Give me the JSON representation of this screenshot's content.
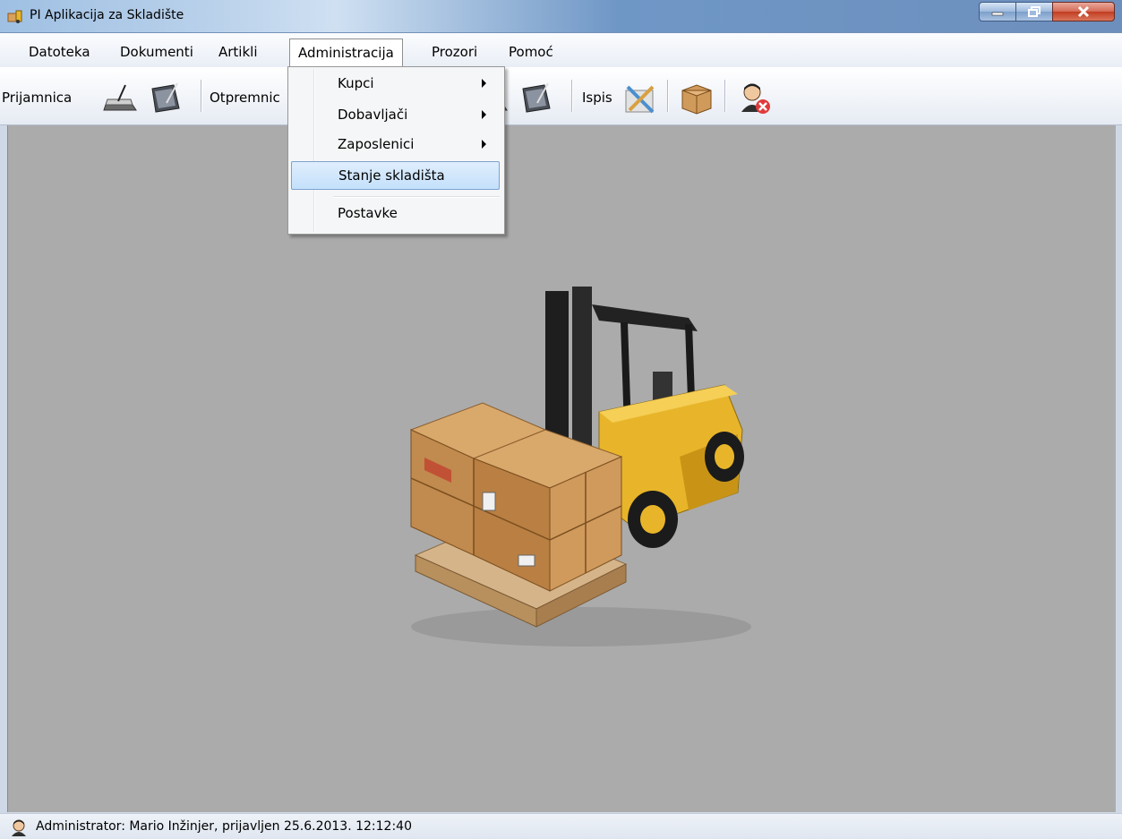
{
  "window": {
    "title": "PI Aplikacija za Skladište"
  },
  "menubar": {
    "items": [
      {
        "label": "Datoteka"
      },
      {
        "label": "Dokumenti"
      },
      {
        "label": "Artikli"
      },
      {
        "label": "Administracija"
      },
      {
        "label": "Prozori"
      },
      {
        "label": "Pomoć"
      }
    ]
  },
  "toolbar": {
    "prijamnica_label": "Prijamnica",
    "otpremnica_label": "Otpremnic",
    "ispis_label": "Ispis"
  },
  "dropdown": {
    "items": [
      {
        "label": "Kupci",
        "submenu": true
      },
      {
        "label": "Dobavljači",
        "submenu": true
      },
      {
        "label": "Zaposlenici",
        "submenu": true
      },
      {
        "label": "Stanje skladišta",
        "submenu": false,
        "highlighted": true
      },
      {
        "label": "Postavke",
        "submenu": false
      }
    ]
  },
  "statusbar": {
    "text": "Administrator: Mario Inžinjer, prijavljen 25.6.2013. 12:12:40"
  },
  "colors": {
    "client_background": "#ababab",
    "highlight": "#c4e0fb",
    "forklift_yellow": "#e8b52a",
    "box_cardboard": "#c9955b"
  }
}
